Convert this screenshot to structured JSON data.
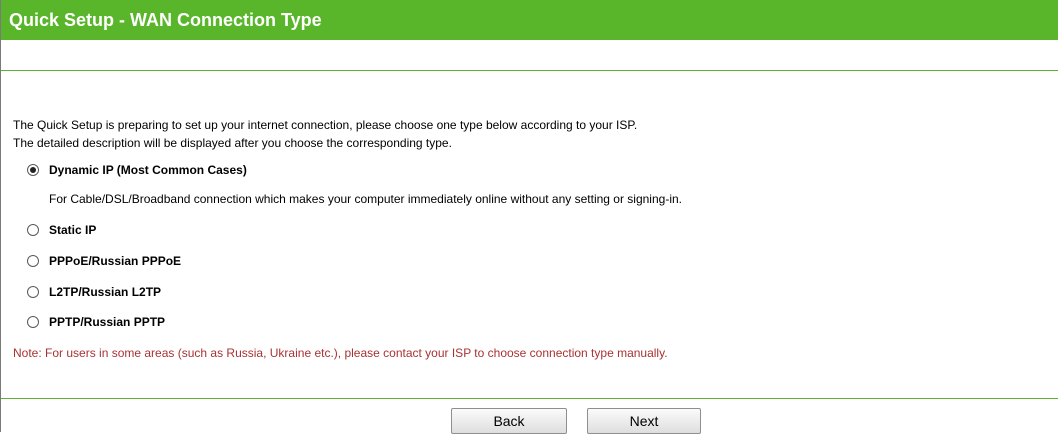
{
  "header": {
    "title": "Quick Setup - WAN Connection Type"
  },
  "intro": {
    "line1": "The Quick Setup is preparing to set up your internet connection, please choose one type below according to your ISP.",
    "line2": "The detailed description will be displayed after you choose the corresponding type."
  },
  "options": [
    {
      "label": "Dynamic IP (Most Common Cases)",
      "selected": true,
      "description": "For Cable/DSL/Broadband connection which makes your computer immediately online without any setting or signing-in."
    },
    {
      "label": "Static IP",
      "selected": false
    },
    {
      "label": "PPPoE/Russian PPPoE",
      "selected": false
    },
    {
      "label": "L2TP/Russian L2TP",
      "selected": false
    },
    {
      "label": "PPTP/Russian PPTP",
      "selected": false
    }
  ],
  "note": "Note: For users in some areas (such as Russia, Ukraine etc.), please contact your ISP to choose connection type manually.",
  "buttons": {
    "back_label": "Back",
    "next_label": "Next"
  },
  "colors": {
    "header_bg": "#59b52a",
    "note_text": "#a83232"
  }
}
